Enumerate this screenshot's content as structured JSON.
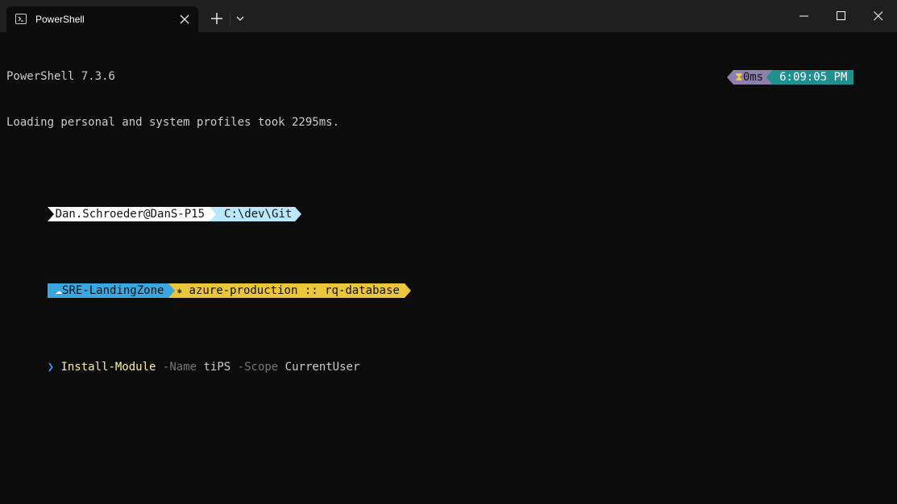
{
  "window": {
    "tab_title": "PowerShell",
    "icons": {
      "tab": "powershell-icon",
      "close_tab": "close-icon",
      "new_tab": "plus-icon",
      "dropdown": "chevron-down-icon",
      "minimize": "minimize-icon",
      "maximize": "maximize-icon",
      "close_window": "close-icon"
    }
  },
  "terminal": {
    "line1": "PowerShell 7.3.6",
    "line2": "Loading personal and system profiles took 2295ms.",
    "prompt": {
      "user_host": "Dan.Schroeder@DanS-P15",
      "path": "C:\\dev\\Git",
      "cloud_icon": "☁",
      "azure_subscription": "SRE-LandingZone",
      "k8s_icon": "⎈",
      "k8s_context": "azure-production :: rq-database",
      "exec_icon": "⧗",
      "exec_time": "0ms",
      "clock": "6:09:05 PM",
      "prompt_char": "❯"
    },
    "command": {
      "keyword": "Install-Module",
      "param1": "-Name",
      "arg1": "tiPS",
      "param2": "-Scope",
      "arg2": "CurrentUser"
    }
  },
  "colors": {
    "terminal_bg": "#0c0c0c",
    "titlebar_bg": "#1f1f1f",
    "user_host_bg": "#ffffff",
    "path_bg": "#b9e8ff",
    "azure_bg": "#3aa7e0",
    "k8s_bg": "#ecc63a",
    "exec_bg": "#8f7fac",
    "clock_bg": "#1f8f8f",
    "prompt_char": "#3a96dd"
  }
}
